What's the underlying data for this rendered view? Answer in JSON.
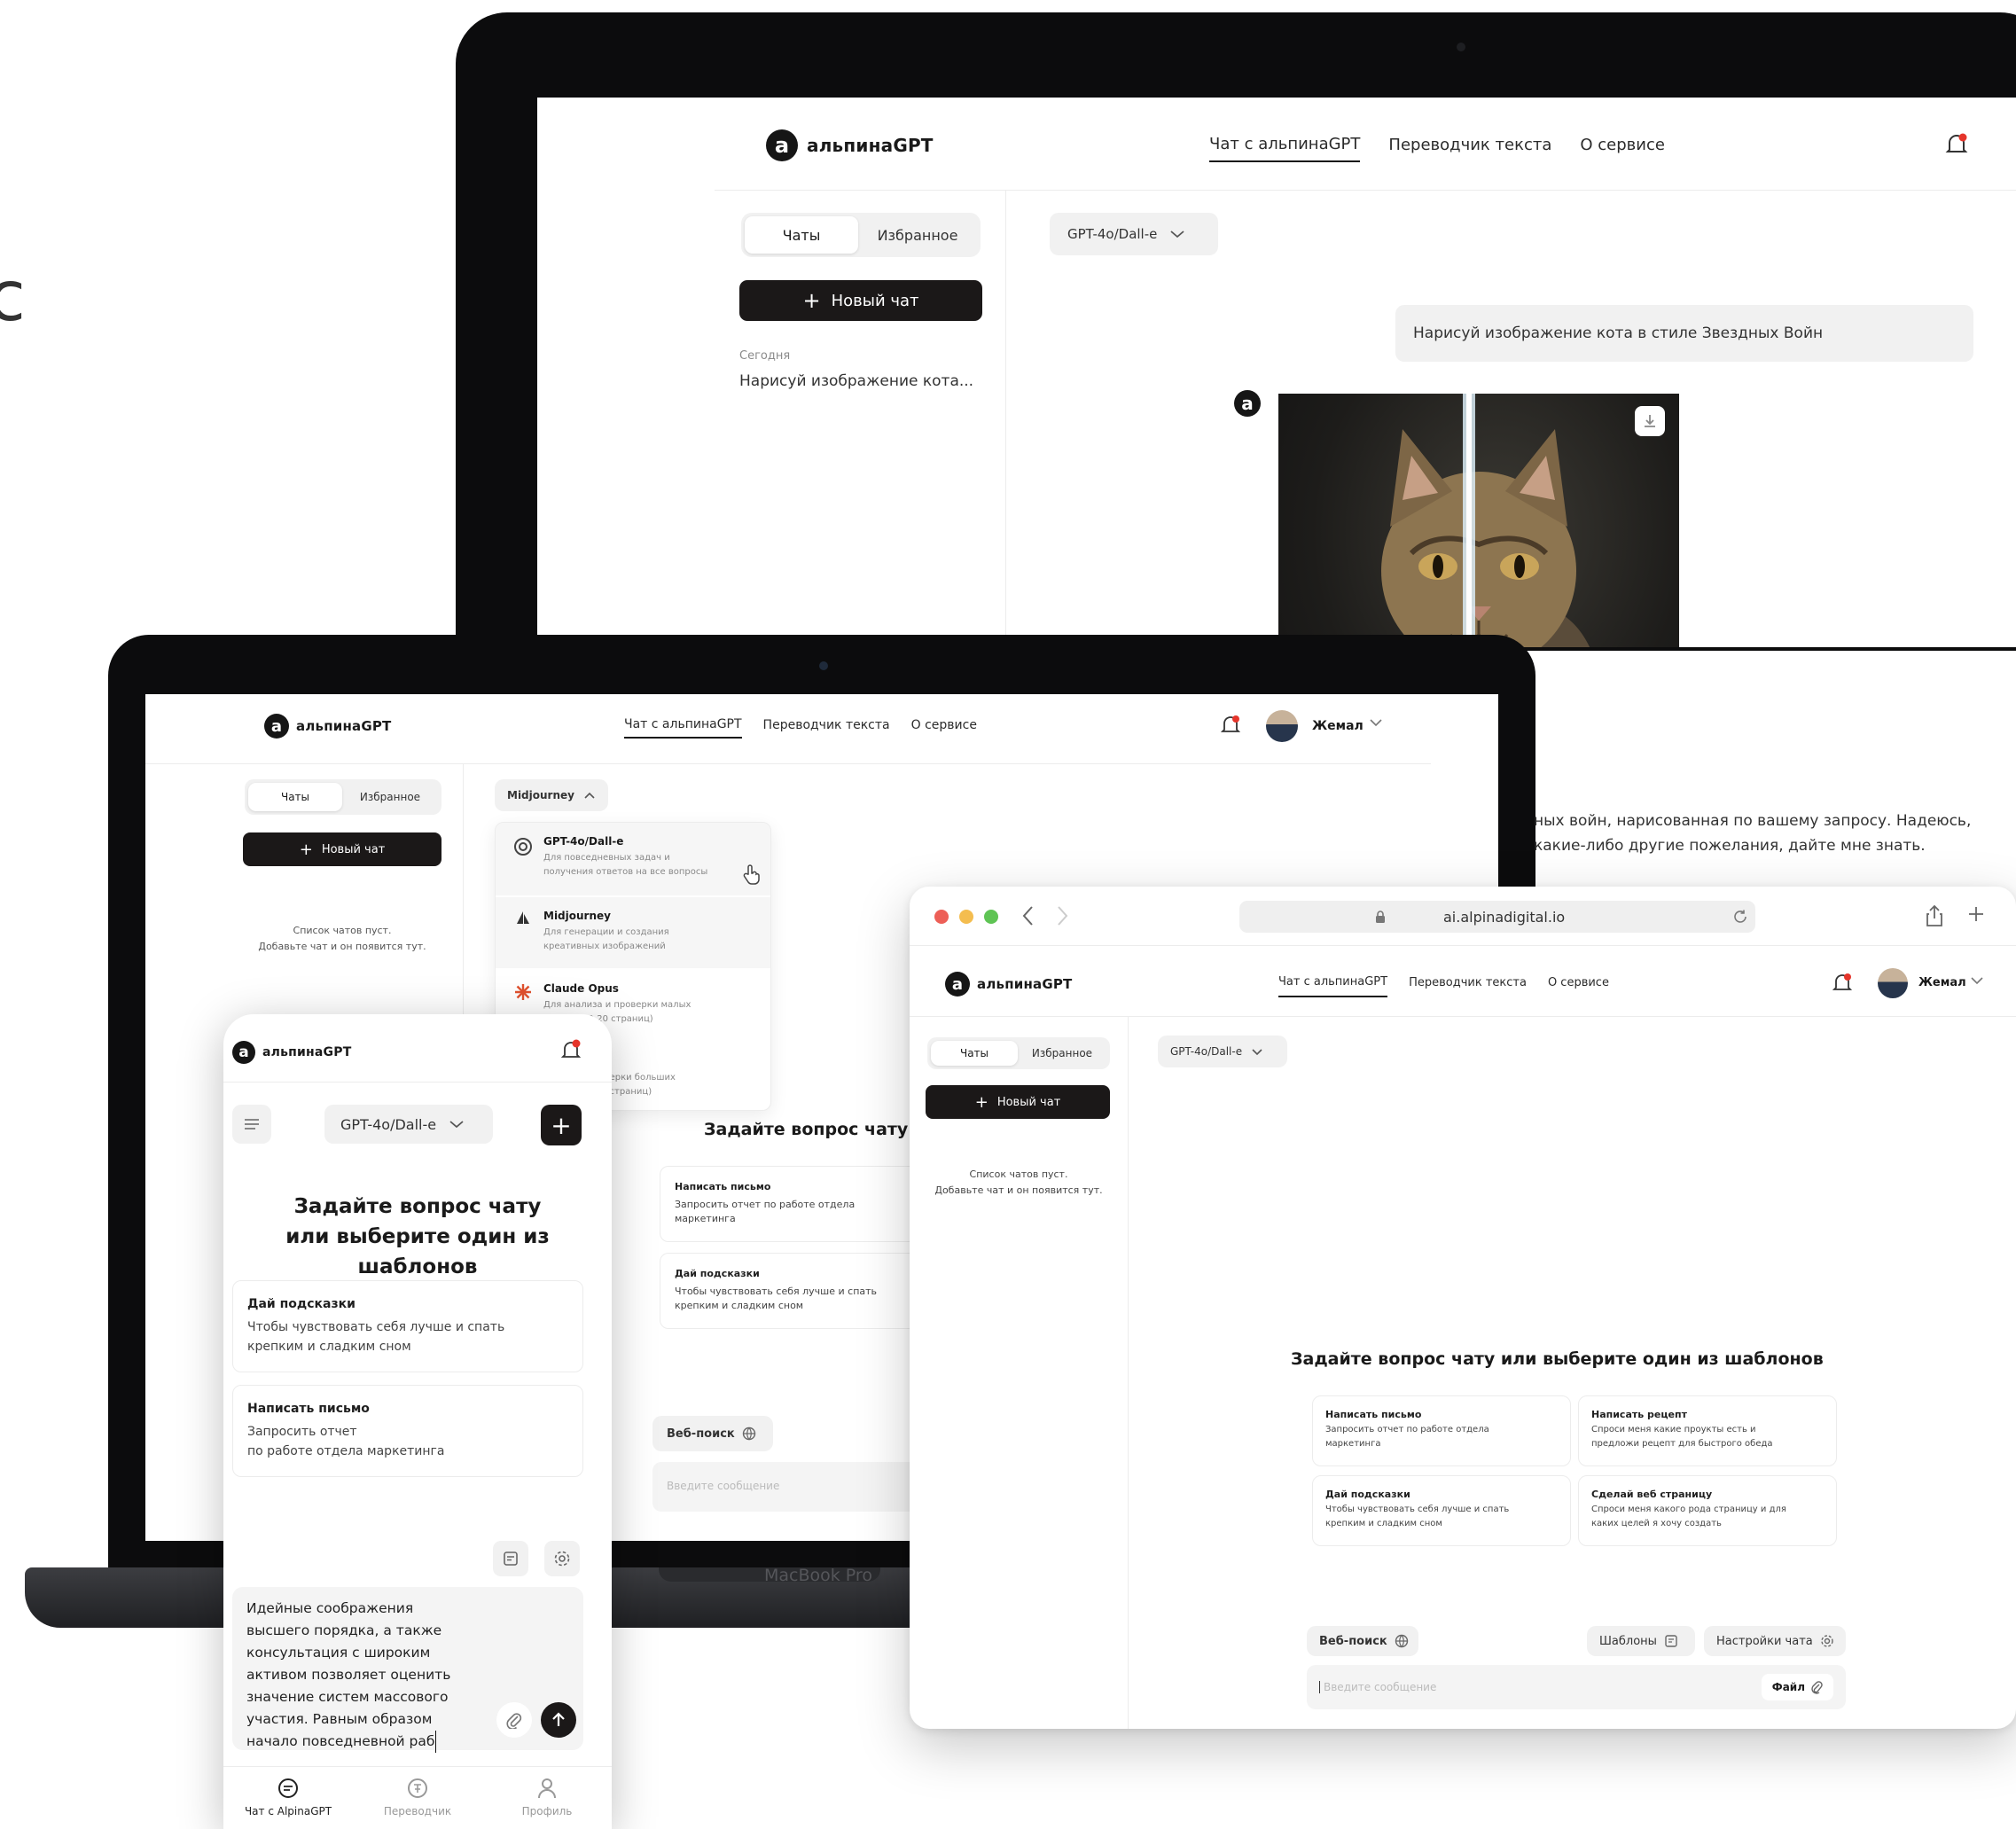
{
  "brand": {
    "logo_letter": "a",
    "name": "альпинаGPT"
  },
  "nav": {
    "chat": "Чат с альпинаGPT",
    "translator": "Переводчик текста",
    "about": "О сервисе"
  },
  "user": {
    "name": "Жемал"
  },
  "sidebar": {
    "tab_chats": "Чаты",
    "tab_favorites": "Избранное",
    "new_chat": "Новый чат",
    "today_label": "Сегодня",
    "recent_chat": "Нарисуй изображение кота...",
    "empty_line1": "Список чатов пуст.",
    "empty_line2": "Добавьте чат и он появится тут."
  },
  "big_laptop": {
    "model": "GPT-4o/Dall-e",
    "user_message": "Нарисуй изображение кота в стиле Звездных Войн",
    "answer_line1": "ных войн, нарисованная по вашему запросу. Надеюсь,",
    "answer_line2": "какие-либо другие пожелания, дайте мне знать."
  },
  "mac": {
    "model": "Midjourney",
    "dropdown": [
      {
        "name": "GPT-4o/Dall-e",
        "desc1": "Для повседневных задач и",
        "desc2": "получения ответов на все вопросы"
      },
      {
        "name": "Midjourney",
        "desc1": "Для генерации и создания",
        "desc2": "креативных изображений"
      },
      {
        "name": "Claude Opus",
        "desc1": "Для анализа и проверки малых",
        "desc2": "(10-20 страниц)"
      },
      {
        "name": "",
        "desc1": "и проверки больших",
        "desc2": "(300+ страниц)"
      }
    ],
    "heading": "Задайте вопрос чату и",
    "cards": [
      {
        "title": "Написать письмо",
        "d1": "Запросить отчет по работе отдела",
        "d2": "маркетинга"
      },
      {
        "title": "Дай подсказки",
        "d1": "Чтобы чувствовать себя лучше и спать",
        "d2": "крепким и сладким сном"
      }
    ],
    "web_search": "Веб-поиск",
    "input_placeholder": "Введите сообщение",
    "device_label": "MacBook Pro"
  },
  "browser": {
    "url": "ai.alpinadigital.io",
    "model": "GPT-4o/Dall-e",
    "heading": "Задайте вопрос чату или выберите один из шаблонов",
    "cards": [
      {
        "title": "Написать письмо",
        "d1": "Запросить отчет по работе отдела",
        "d2": "маркетинга"
      },
      {
        "title": "Написать рецепт",
        "d1": "Спроси меня какие проукты есть и",
        "d2": "предложи рецепт для быстрого обеда"
      },
      {
        "title": "Дай подсказки",
        "d1": "Чтобы чувствовать себя лучше и спать",
        "d2": "крепким и сладким сном"
      },
      {
        "title": "Сделай веб страницу",
        "d1": "Спроси меня какого рода страницу и для",
        "d2": "каких целей я хочу создать"
      }
    ],
    "web_search": "Веб-поиск",
    "templates": "Шаблоны",
    "chat_settings": "Настройки чата",
    "input_placeholder": "Введите сообщение",
    "file": "Файл"
  },
  "phone": {
    "model": "GPT-4o/Dall-e",
    "heading1": "Задайте вопрос чату",
    "heading2": "или выберите один из шаблонов",
    "cards": [
      {
        "title": "Дай подсказки",
        "d1": "Чтобы чувствовать себя лучше и спать",
        "d2": "крепким и сладким сном"
      },
      {
        "title": "Написать письмо",
        "d1": "Запросить отчет",
        "d2": "по работе отдела маркетинга"
      }
    ],
    "draft": [
      "Идейные соображения",
      "высшего порядка, а также",
      "консультация с широким",
      "активом позволяет оценить",
      "значение систем массового",
      "участия. Равным образом",
      "начало повседневной раб"
    ],
    "tabbar": {
      "chat": "Чат с AlpinaGPT",
      "translator": "Переводчик",
      "profile": "Профиль"
    }
  },
  "edge_glyph": "с",
  "colors": {
    "accent": "#1b1818",
    "notify": "#e5352b",
    "surface": "#f1f1f1"
  }
}
